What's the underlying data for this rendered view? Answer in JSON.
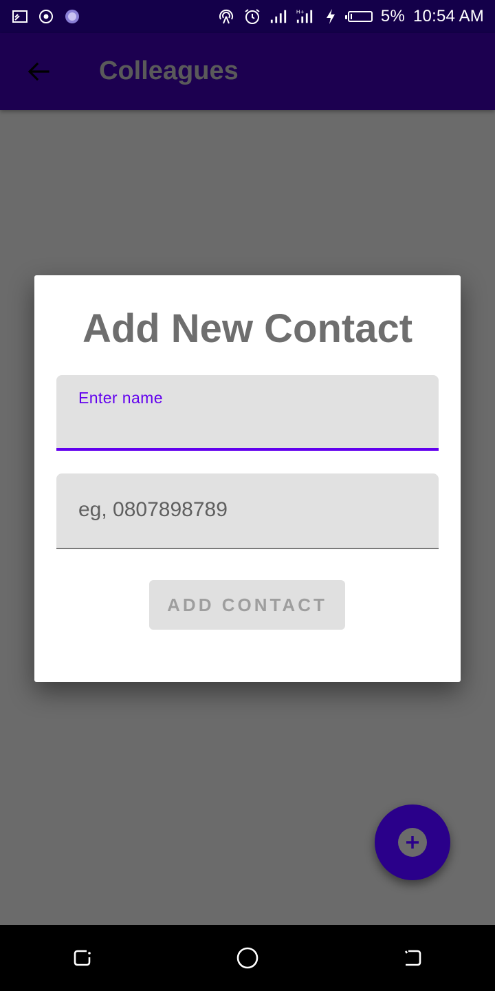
{
  "status_bar": {
    "left_icons": [
      "cast-icon",
      "target-icon",
      "app-logo-icon"
    ],
    "right_icons": [
      "hotspot-icon",
      "alarm-icon",
      "signal-icon",
      "signal-hplus-icon",
      "charging-icon",
      "battery-icon"
    ],
    "battery_percent": "5%",
    "battery_level": 0.05,
    "time": "10:54 AM"
  },
  "app_bar": {
    "title": "Colleagues",
    "back_icon": "arrow-back-icon"
  },
  "dialog": {
    "title": "Add New Contact",
    "name_field": {
      "label": "Enter name",
      "value": ""
    },
    "phone_field": {
      "placeholder": "eg, 0807898789",
      "value": ""
    },
    "add_button_label": "ADD CONTACT"
  },
  "fab": {
    "icon": "plus-icon"
  },
  "nav_bar": {
    "icons": [
      "recent-apps-icon",
      "home-icon",
      "back-nav-icon"
    ]
  },
  "colors": {
    "status_bar_bg": "#14004a",
    "app_bar_bg": "#1c0050",
    "accent": "#6200ee",
    "fab_bg": "#2a008a",
    "scrim": "#6b6b6b"
  }
}
